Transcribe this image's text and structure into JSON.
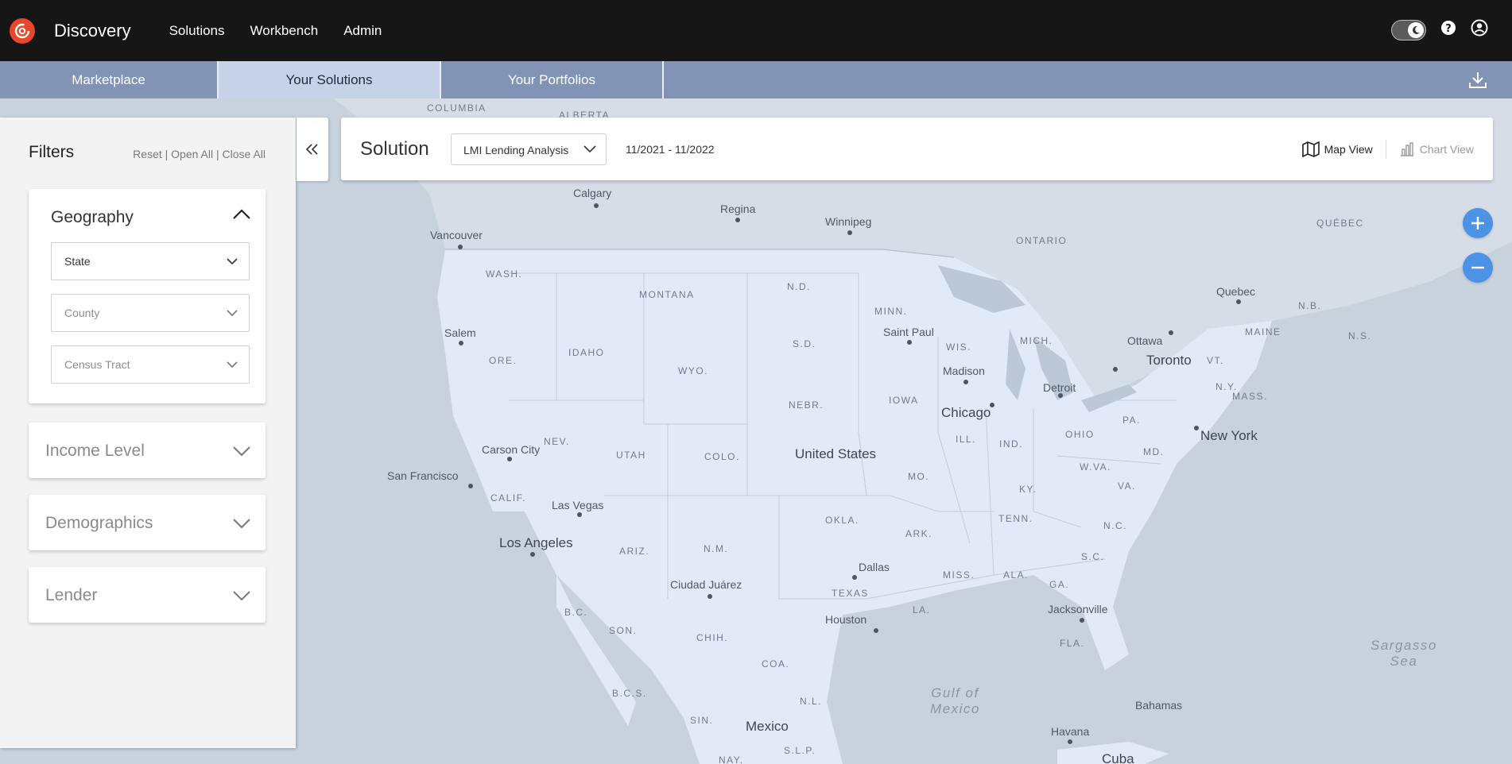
{
  "app": {
    "title": "Discovery"
  },
  "nav": {
    "items": [
      "Solutions",
      "Workbench",
      "Admin"
    ]
  },
  "tabs": [
    {
      "label": "Marketplace"
    },
    {
      "label": "Your Solutions",
      "active": true
    },
    {
      "label": "Your Portfolios"
    }
  ],
  "filters": {
    "title": "Filters",
    "reset": "Reset",
    "open_all": "Open All",
    "close_all": "Close All",
    "separator": "|",
    "geography": {
      "title": "Geography",
      "state": "State",
      "county": "County",
      "census_tract": "Census Tract"
    },
    "income_level": "Income Level",
    "demographics": "Demographics",
    "lender": "Lender"
  },
  "solution": {
    "title": "Solution",
    "selected": "LMI Lending Analysis",
    "date_range": "11/2021 - 11/2022",
    "map_view": "Map View",
    "chart_view": "Chart View"
  },
  "map_labels": {
    "columbia": "COLUMBIA",
    "alberta": "ALBERTA",
    "calgary": "Calgary",
    "regina": "Regina",
    "winnipeg": "Winnipeg",
    "ontario": "ONTARIO",
    "quebec_region": "QUÉBEC",
    "vancouver": "Vancouver",
    "wash": "WASH.",
    "montana": "MONTANA",
    "nd": "N.D.",
    "minn": "MINN.",
    "quebec": "Quebec",
    "nb": "N.B.",
    "ns": "N.S.",
    "maine": "MAINE",
    "ottawa": "Ottawa",
    "toronto": "Toronto",
    "salem": "Salem",
    "ore": "ORE.",
    "idaho": "IDAHO",
    "sd": "S.D.",
    "saint_paul": "Saint Paul",
    "wis": "WIS.",
    "mich": "MICH.",
    "vt": "VT.",
    "ny": "N.Y.",
    "mass": "MASS.",
    "wyo": "WYO.",
    "madison": "Madison",
    "detroit": "Detroit",
    "iowa": "IOWA",
    "nebr": "NEBR.",
    "chicago": "Chicago",
    "pa": "PA.",
    "ohio": "OHIO",
    "new_york": "New York",
    "ill": "ILL.",
    "ind": "IND.",
    "nev": "NEV.",
    "utah": "UTAH",
    "carson_city": "Carson City",
    "colo": "COLO.",
    "united_states": "United States",
    "md": "MD.",
    "wva": "W.VA.",
    "san_francisco": "San Francisco",
    "mo": "MO.",
    "ky": "KY.",
    "va": "VA.",
    "calif": "CALIF.",
    "las_vegas": "Las Vegas",
    "okla": "OKLA.",
    "tenn": "TENN.",
    "nc": "N.C.",
    "los_angeles": "Los Angeles",
    "ariz": "ARIZ.",
    "nm": "N.M.",
    "ark": "ARK.",
    "sc": "S.C.",
    "dallas": "Dallas",
    "miss": "MISS.",
    "ala": "ALA.",
    "ga": "GA.",
    "ciudad_juarez": "Ciudad Juárez",
    "texas": "TEXAS",
    "bc": "B.C.",
    "la": "LA.",
    "jacksonville": "Jacksonville",
    "son": "SON.",
    "chih": "CHIH.",
    "houston": "Houston",
    "fla": "FLA.",
    "sargasso": "Sargasso",
    "sea": "Sea",
    "coa": "COA.",
    "gulf_of": "Gulf of",
    "mexico_gulf": "Mexico",
    "bcs": "B.C.S.",
    "nl": "N.L.",
    "bahamas": "Bahamas",
    "sin": "SIN.",
    "mexico": "Mexico",
    "havana": "Havana",
    "slp": "S.L.P.",
    "nay": "NAY.",
    "cuba": "Cuba"
  },
  "icons": {
    "logo": "brand-logo-icon",
    "theme_toggle": "moon-icon",
    "help": "help-icon",
    "account": "user-icon",
    "download": "download-icon"
  },
  "colors": {
    "topbar": "#161616",
    "tabstrip": "#8194b6",
    "tab_active": "#c6d3e7",
    "accent": "#e8472c",
    "zoom": "#4c93e6",
    "land_us": "#e3eaf7",
    "water": "#c8d2dd"
  }
}
